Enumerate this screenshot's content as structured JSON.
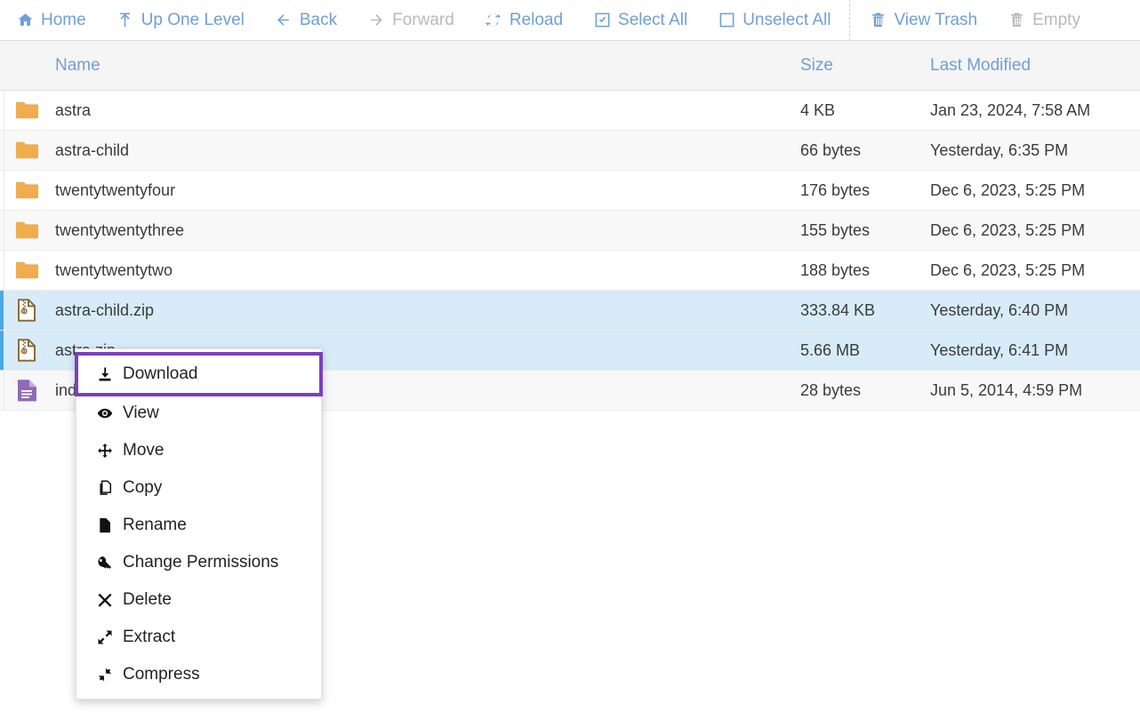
{
  "toolbar": {
    "items": [
      {
        "label": "Home",
        "icon": "home-icon",
        "disabled": false
      },
      {
        "label": "Up One Level",
        "icon": "up-arrow-icon",
        "disabled": false
      },
      {
        "label": "Back",
        "icon": "arrow-left-icon",
        "disabled": false
      },
      {
        "label": "Forward",
        "icon": "arrow-right-icon",
        "disabled": true
      },
      {
        "label": "Reload",
        "icon": "reload-icon",
        "disabled": false
      },
      {
        "label": "Select All",
        "icon": "checkbox-checked-icon",
        "disabled": false
      },
      {
        "label": "Unselect All",
        "icon": "checkbox-empty-icon",
        "disabled": false
      },
      {
        "label": "View Trash",
        "icon": "trash-icon",
        "disabled": false
      },
      {
        "label": "Empty",
        "icon": "trash-icon",
        "disabled": true
      }
    ],
    "divider_after_index": 6,
    "link_color": "#6f9fd8",
    "disabled_color": "#b9b9b9"
  },
  "table": {
    "columns": {
      "name": "Name",
      "size": "Size",
      "modified": "Last Modified"
    },
    "rows": [
      {
        "icon": "folder-icon",
        "name": "astra",
        "size": "4 KB",
        "modified": "Jan 23, 2024, 7:58 AM",
        "selected": false
      },
      {
        "icon": "folder-icon",
        "name": "astra-child",
        "size": "66 bytes",
        "modified": "Yesterday, 6:35 PM",
        "selected": false
      },
      {
        "icon": "folder-icon",
        "name": "twentytwentyfour",
        "size": "176 bytes",
        "modified": "Dec 6, 2023, 5:25 PM",
        "selected": false
      },
      {
        "icon": "folder-icon",
        "name": "twentytwentythree",
        "size": "155 bytes",
        "modified": "Dec 6, 2023, 5:25 PM",
        "selected": false
      },
      {
        "icon": "folder-icon",
        "name": "twentytwentytwo",
        "size": "188 bytes",
        "modified": "Dec 6, 2023, 5:25 PM",
        "selected": false
      },
      {
        "icon": "zip-icon",
        "name": "astra-child.zip",
        "size": "333.84 KB",
        "modified": "Yesterday, 6:40 PM",
        "selected": true
      },
      {
        "icon": "zip-icon",
        "name": "astra.zip",
        "size": "5.66 MB",
        "modified": "Yesterday, 6:41 PM",
        "selected": true
      },
      {
        "icon": "document-icon",
        "name": "index.php",
        "size": "28 bytes",
        "modified": "Jun 5, 2014, 4:59 PM",
        "selected": false
      }
    ],
    "selected_row_bg": "#d7ebf9",
    "selected_accent": "#49a9e8",
    "folder_color": "#f0ad4e",
    "zip_color": "#8a6d3b",
    "document_color": "#8e6bb5"
  },
  "context_menu": {
    "highlight_color": "#7b3fbf",
    "items": [
      {
        "label": "Download",
        "icon": "download-icon",
        "highlighted": true
      },
      {
        "label": "View",
        "icon": "eye-icon",
        "highlighted": false
      },
      {
        "label": "Move",
        "icon": "move-icon",
        "highlighted": false
      },
      {
        "label": "Copy",
        "icon": "copy-icon",
        "highlighted": false
      },
      {
        "label": "Rename",
        "icon": "file-icon",
        "highlighted": false
      },
      {
        "label": "Change Permissions",
        "icon": "key-icon",
        "highlighted": false
      },
      {
        "label": "Delete",
        "icon": "x-icon",
        "highlighted": false
      },
      {
        "label": "Extract",
        "icon": "expand-icon",
        "highlighted": false
      },
      {
        "label": "Compress",
        "icon": "compress-icon",
        "highlighted": false
      }
    ]
  }
}
